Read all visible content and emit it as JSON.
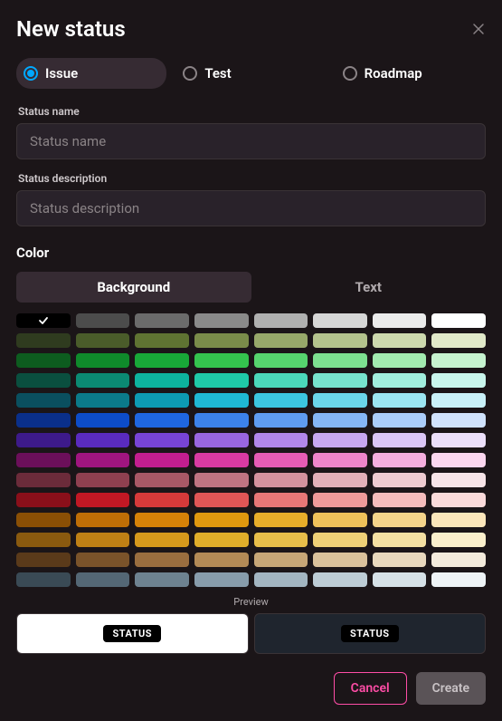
{
  "header": {
    "title": "New status"
  },
  "types": [
    {
      "label": "Issue",
      "selected": true
    },
    {
      "label": "Test",
      "selected": false
    },
    {
      "label": "Roadmap",
      "selected": false
    }
  ],
  "fields": {
    "name_label": "Status name",
    "name_placeholder": "Status name",
    "name_value": "",
    "desc_label": "Status description",
    "desc_placeholder": "Status description",
    "desc_value": ""
  },
  "color_section": {
    "label": "Color"
  },
  "color_toggle": {
    "bg": "Background",
    "text": "Text",
    "active": "bg"
  },
  "swatches": [
    [
      "#000000",
      "#4c4c4c",
      "#6b6b6b",
      "#8a8a8a",
      "#b0b0b0",
      "#d6d6d6",
      "#ebebeb",
      "#ffffff"
    ],
    [
      "#2f3b1f",
      "#4a5c2a",
      "#5f7332",
      "#7a8c4a",
      "#97a86a",
      "#b4c38d",
      "#cdd9ae",
      "#e1e9c9"
    ],
    [
      "#0d5c1f",
      "#0f8a2b",
      "#18a838",
      "#34c34e",
      "#56d46e",
      "#7de090",
      "#a2ebb0",
      "#c6f3cf"
    ],
    [
      "#0a4f3f",
      "#0b8a73",
      "#0db39e",
      "#1fc9a8",
      "#4bd8ba",
      "#77e3cd",
      "#a1eedd",
      "#c9f6ec"
    ],
    [
      "#0a4f5f",
      "#0b7a8a",
      "#0d9bb3",
      "#1fb8d4",
      "#3cc6e0",
      "#6bd6ea",
      "#9be5f1",
      "#c9f1f8"
    ],
    [
      "#0a2f8a",
      "#0d4cc9",
      "#1f66e0",
      "#3c82ea",
      "#5f9cf1",
      "#85b6f6",
      "#abcdfa",
      "#d0e2fc"
    ],
    [
      "#3d1a8a",
      "#5a2bbf",
      "#7844d6",
      "#9966e0",
      "#b287ea",
      "#c8a8f1",
      "#dbc6f6",
      "#ecdffa"
    ],
    [
      "#6b0f5a",
      "#a0157f",
      "#c21e8f",
      "#d93aa2",
      "#e65cb5",
      "#ee85ca",
      "#f5aede",
      "#fbd6ef"
    ],
    [
      "#6b2b3a",
      "#8f4050",
      "#a85866",
      "#bf7482",
      "#d4929e",
      "#e3b0b9",
      "#eecbd1",
      "#f7e4e8"
    ],
    [
      "#8a0f1a",
      "#c21824",
      "#d63a3a",
      "#e05656",
      "#e87777",
      "#ef9a9a",
      "#f5bcbc",
      "#fadada"
    ],
    [
      "#8a4f05",
      "#bf6e06",
      "#d68208",
      "#e0980f",
      "#e8ad2a",
      "#efc15a",
      "#f5d48a",
      "#fbe6ba"
    ],
    [
      "#8a5a0f",
      "#bf8015",
      "#d6991c",
      "#e0ad2a",
      "#e8be4a",
      "#efd077",
      "#f5e0a2",
      "#fbefcc"
    ],
    [
      "#5a3a1a",
      "#7a532a",
      "#9a6e3f",
      "#b38a56",
      "#c7a677",
      "#dac19b",
      "#e9d8bd",
      "#f4ebdc"
    ],
    [
      "#3a4a55",
      "#546775",
      "#6e8290",
      "#889cab",
      "#a3b5c1",
      "#bdccd5",
      "#d6e1e7",
      "#eef3f6"
    ]
  ],
  "selected_swatch": {
    "row": 0,
    "col": 0
  },
  "preview": {
    "label": "Preview",
    "badge": "STATUS"
  },
  "footer": {
    "cancel": "Cancel",
    "create": "Create"
  }
}
